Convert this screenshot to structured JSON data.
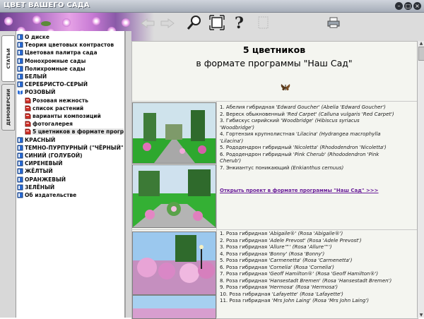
{
  "window": {
    "title": "ЦВЕТ ВАШЕГО САДА"
  },
  "toolbar": {
    "icons": [
      "back-arrow-icon",
      "forward-arrow-icon",
      "magnifier-icon",
      "fit-page-icon",
      "help-icon",
      "copy-frame-icon",
      "print-icon"
    ]
  },
  "side_tabs": [
    "СТАТЬИ",
    "ДЕМОВЕРСИИ"
  ],
  "tree": [
    {
      "label": "О диске",
      "icon": "book-icon",
      "level": 0
    },
    {
      "label": "Теория цветовых контрастов",
      "icon": "book-icon",
      "level": 0
    },
    {
      "label": "Цветовая палитра сада",
      "icon": "book-icon",
      "level": 0
    },
    {
      "label": "Монохромные сады",
      "icon": "book-icon",
      "level": 0
    },
    {
      "label": "Полихромные сады",
      "icon": "book-icon",
      "level": 0
    },
    {
      "label": "БЕЛЫЙ",
      "icon": "book-icon",
      "level": 0
    },
    {
      "label": "СЕРЕБРИСТО-СЕРЫЙ",
      "icon": "book-icon",
      "level": 0
    },
    {
      "label": "РОЗОВЫЙ",
      "icon": "book-open-icon",
      "level": 0
    },
    {
      "label": "Розовая нежность",
      "icon": "page-icon",
      "level": 1
    },
    {
      "label": "список растений",
      "icon": "page-icon",
      "level": 1
    },
    {
      "label": "варианты композиций",
      "icon": "page-icon",
      "level": 1
    },
    {
      "label": "фотогалерея",
      "icon": "page-icon",
      "level": 1
    },
    {
      "label": "5 цветников в формате прогр",
      "icon": "page-icon",
      "level": 1,
      "selected": true
    },
    {
      "label": "КРАСНЫЙ",
      "icon": "book-icon",
      "level": 0
    },
    {
      "label": "ТЕМНО-ПУРПУРНЫЙ (\"ЧЁРНЫЙ\"",
      "icon": "book-icon",
      "level": 0
    },
    {
      "label": "СИНИЙ (ГОЛУБОЙ)",
      "icon": "book-icon",
      "level": 0
    },
    {
      "label": "СИРЕНЕВЫЙ",
      "icon": "book-icon",
      "level": 0
    },
    {
      "label": "ЖЁЛТЫЙ",
      "icon": "book-icon",
      "level": 0
    },
    {
      "label": "ОРАНЖЕВЫЙ",
      "icon": "book-icon",
      "level": 0
    },
    {
      "label": "ЗЕЛЁНЫЙ",
      "icon": "book-icon",
      "level": 0
    },
    {
      "label": "Об издательстве",
      "icon": "book-icon",
      "level": 0
    }
  ],
  "content": {
    "heading1": "5 цветников",
    "heading2": "в формате программы \"Наш Сад\"",
    "section1_items": [
      {
        "n": "1.",
        "ru": "Абелия гибридная",
        "cv": "'Edward Goucher'",
        "lat": "(Abelia 'Edward Goucher')"
      },
      {
        "n": "2.",
        "ru": "Вереск обыкновенный",
        "cv": "'Red Carpet'",
        "lat": "(Calluna vulgaris 'Red Carpet')"
      },
      {
        "n": "3.",
        "ru": "Гибискус сирийский",
        "cv": "'Woodbridge'",
        "lat": "(Hibiscus syriacus"
      },
      {
        "n": "",
        "ru": "",
        "cv": "",
        "lat": "'Woodbridge')"
      },
      {
        "n": "4.",
        "ru": "Гортензия крупнолистная",
        "cv": "'Lilacina'",
        "lat": "(Hydrangea macrophylla"
      },
      {
        "n": "",
        "ru": "",
        "cv": "",
        "lat": "'Lilacina')"
      },
      {
        "n": "5.",
        "ru": "Рододендрон гибридный",
        "cv": "'Nicoletta'",
        "lat": "(Rhododendron 'Nicoletta')"
      },
      {
        "n": "6.",
        "ru": "Рододендрон гибридный",
        "cv": "'Pink Cherub'",
        "lat": "(Rhododendron 'Pink"
      },
      {
        "n": "",
        "ru": "",
        "cv": "",
        "lat": "Cherub')"
      },
      {
        "n": "7.",
        "ru": "Энкиантус поникающий",
        "cv": "",
        "lat": "(Enkianthus cernuus)"
      }
    ],
    "link": "Открыть проект в формате программы \"Наш Сад\" >>>",
    "section2_items": [
      {
        "n": "1.",
        "ru": "Роза гибридная",
        "cv": "'Abigaile®'",
        "lat": "(Rosa 'Abigaile®')"
      },
      {
        "n": "2.",
        "ru": "Роза гибридная",
        "cv": "'Adele Prevost'",
        "lat": "(Rosa 'Adele Prevost')"
      },
      {
        "n": "3.",
        "ru": "Роза гибридная",
        "cv": "'Allure™'",
        "lat": "(Rosa 'Allure™')"
      },
      {
        "n": "4.",
        "ru": "Роза гибридная",
        "cv": "'Bonny'",
        "lat": "(Rosa 'Bonny')"
      },
      {
        "n": "5.",
        "ru": "Роза гибридная",
        "cv": "'Carmenetta'",
        "lat": "(Rosa 'Carmenetta')"
      },
      {
        "n": "6.",
        "ru": "Роза гибридная",
        "cv": "'Cornelia'",
        "lat": "(Rosa 'Cornelia')"
      },
      {
        "n": "7.",
        "ru": "Роза гибридная",
        "cv": "'Geoff Hamilton®'",
        "lat": "(Rosa 'Geoff Hamilton®')"
      },
      {
        "n": "8.",
        "ru": "Роза гибридная",
        "cv": "'Hansestadt Bremen'",
        "lat": "(Rosa 'Hansestadt Bremen')"
      },
      {
        "n": "9.",
        "ru": "Роза гибридная",
        "cv": "'Hermosa'",
        "lat": "(Rosa 'Hermosa')"
      },
      {
        "n": "10.",
        "ru": "Роза гибридная",
        "cv": "'Lafayette'",
        "lat": "(Rosa 'Lafayette')"
      },
      {
        "n": "11.",
        "ru": "Роза гибридная",
        "cv": "'Mrs John Laing'",
        "lat": "(Rosa 'Mrs John Laing')"
      }
    ]
  },
  "colors": {
    "link": "#6a1e9a",
    "banner_flowers": "#c77ad4",
    "content_bg": "#f4f5f0"
  }
}
